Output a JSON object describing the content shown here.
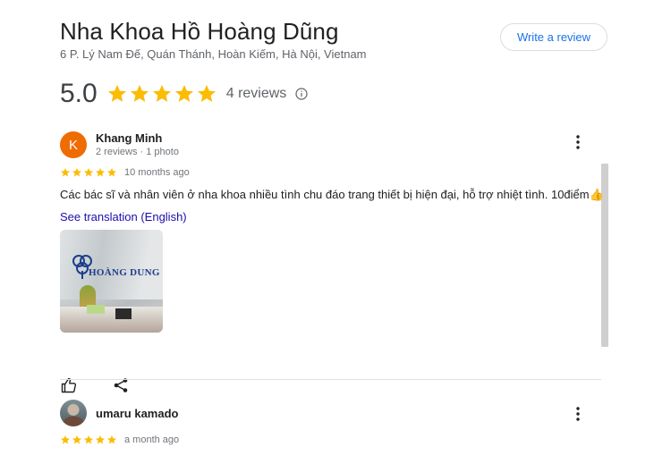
{
  "place": {
    "name": "Nha Khoa Hồ Hoàng Dũng",
    "address": "6 P. Lý Nam Đế, Quán Thánh, Hoàn Kiếm, Hà Nội, Vietnam",
    "write_review_label": "Write a review",
    "rating": "5.0",
    "rating_stars": 5,
    "review_count": "4 reviews"
  },
  "colors": {
    "star": "#fbbc04",
    "link": "#1a73e8",
    "avatar_k": "#ef6c00"
  },
  "reviews": [
    {
      "avatar_letter": "K",
      "name": "Khang Minh",
      "meta": "2 reviews · 1 photo",
      "stars": 5,
      "time": "10 months ago",
      "text": "Các bác sĩ và nhân viên ở nha khoa nhiều tình chu đáo trang thiết bị hiện đại, hỗ trợ nhiệt tình. 10điểm👍",
      "translate_link": "See translation (English)",
      "photo_sign_text": "HOÀNG DUNG"
    },
    {
      "name": "umaru kamado",
      "stars": 5,
      "time": "a month ago"
    }
  ],
  "icons": {
    "more": "more-vert-icon",
    "like": "thumb-up-icon",
    "share": "share-icon",
    "info": "info-icon",
    "star": "star-icon"
  }
}
